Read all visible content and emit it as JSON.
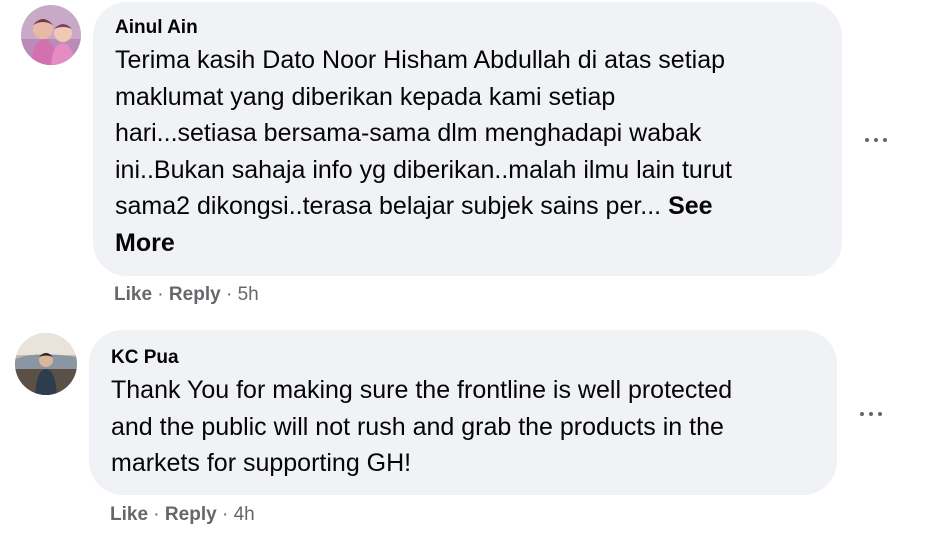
{
  "comments": [
    {
      "author": "Ainul Ain",
      "text": "Terima kasih Dato Noor Hisham Abdullah di atas setiap\nmaklumat yang diberikan kepada kami setiap\nhari...setiasa bersama-sama dlm menghadapi wabak\nini..Bukan sahaja info yg diberikan..malah ilmu lain turut\nsama2 dikongsi..terasa belajar subjek sains per... ",
      "see_more": "See\nMore",
      "like": "Like",
      "sep1": " · ",
      "reply": "Reply",
      "sep2": " · ",
      "time": "5h"
    },
    {
      "author": "KC Pua",
      "text": "Thank You for making sure the frontline is well protected\nand the public will not rush and grab the products in the\nmarkets for supporting GH!",
      "like": "Like",
      "sep1": " · ",
      "reply": "Reply",
      "sep2": " · ",
      "time": "4h"
    }
  ],
  "colors": {
    "bubble_bg": "#f0f2f5",
    "meta_text": "#65676b",
    "icon": "#606770"
  }
}
